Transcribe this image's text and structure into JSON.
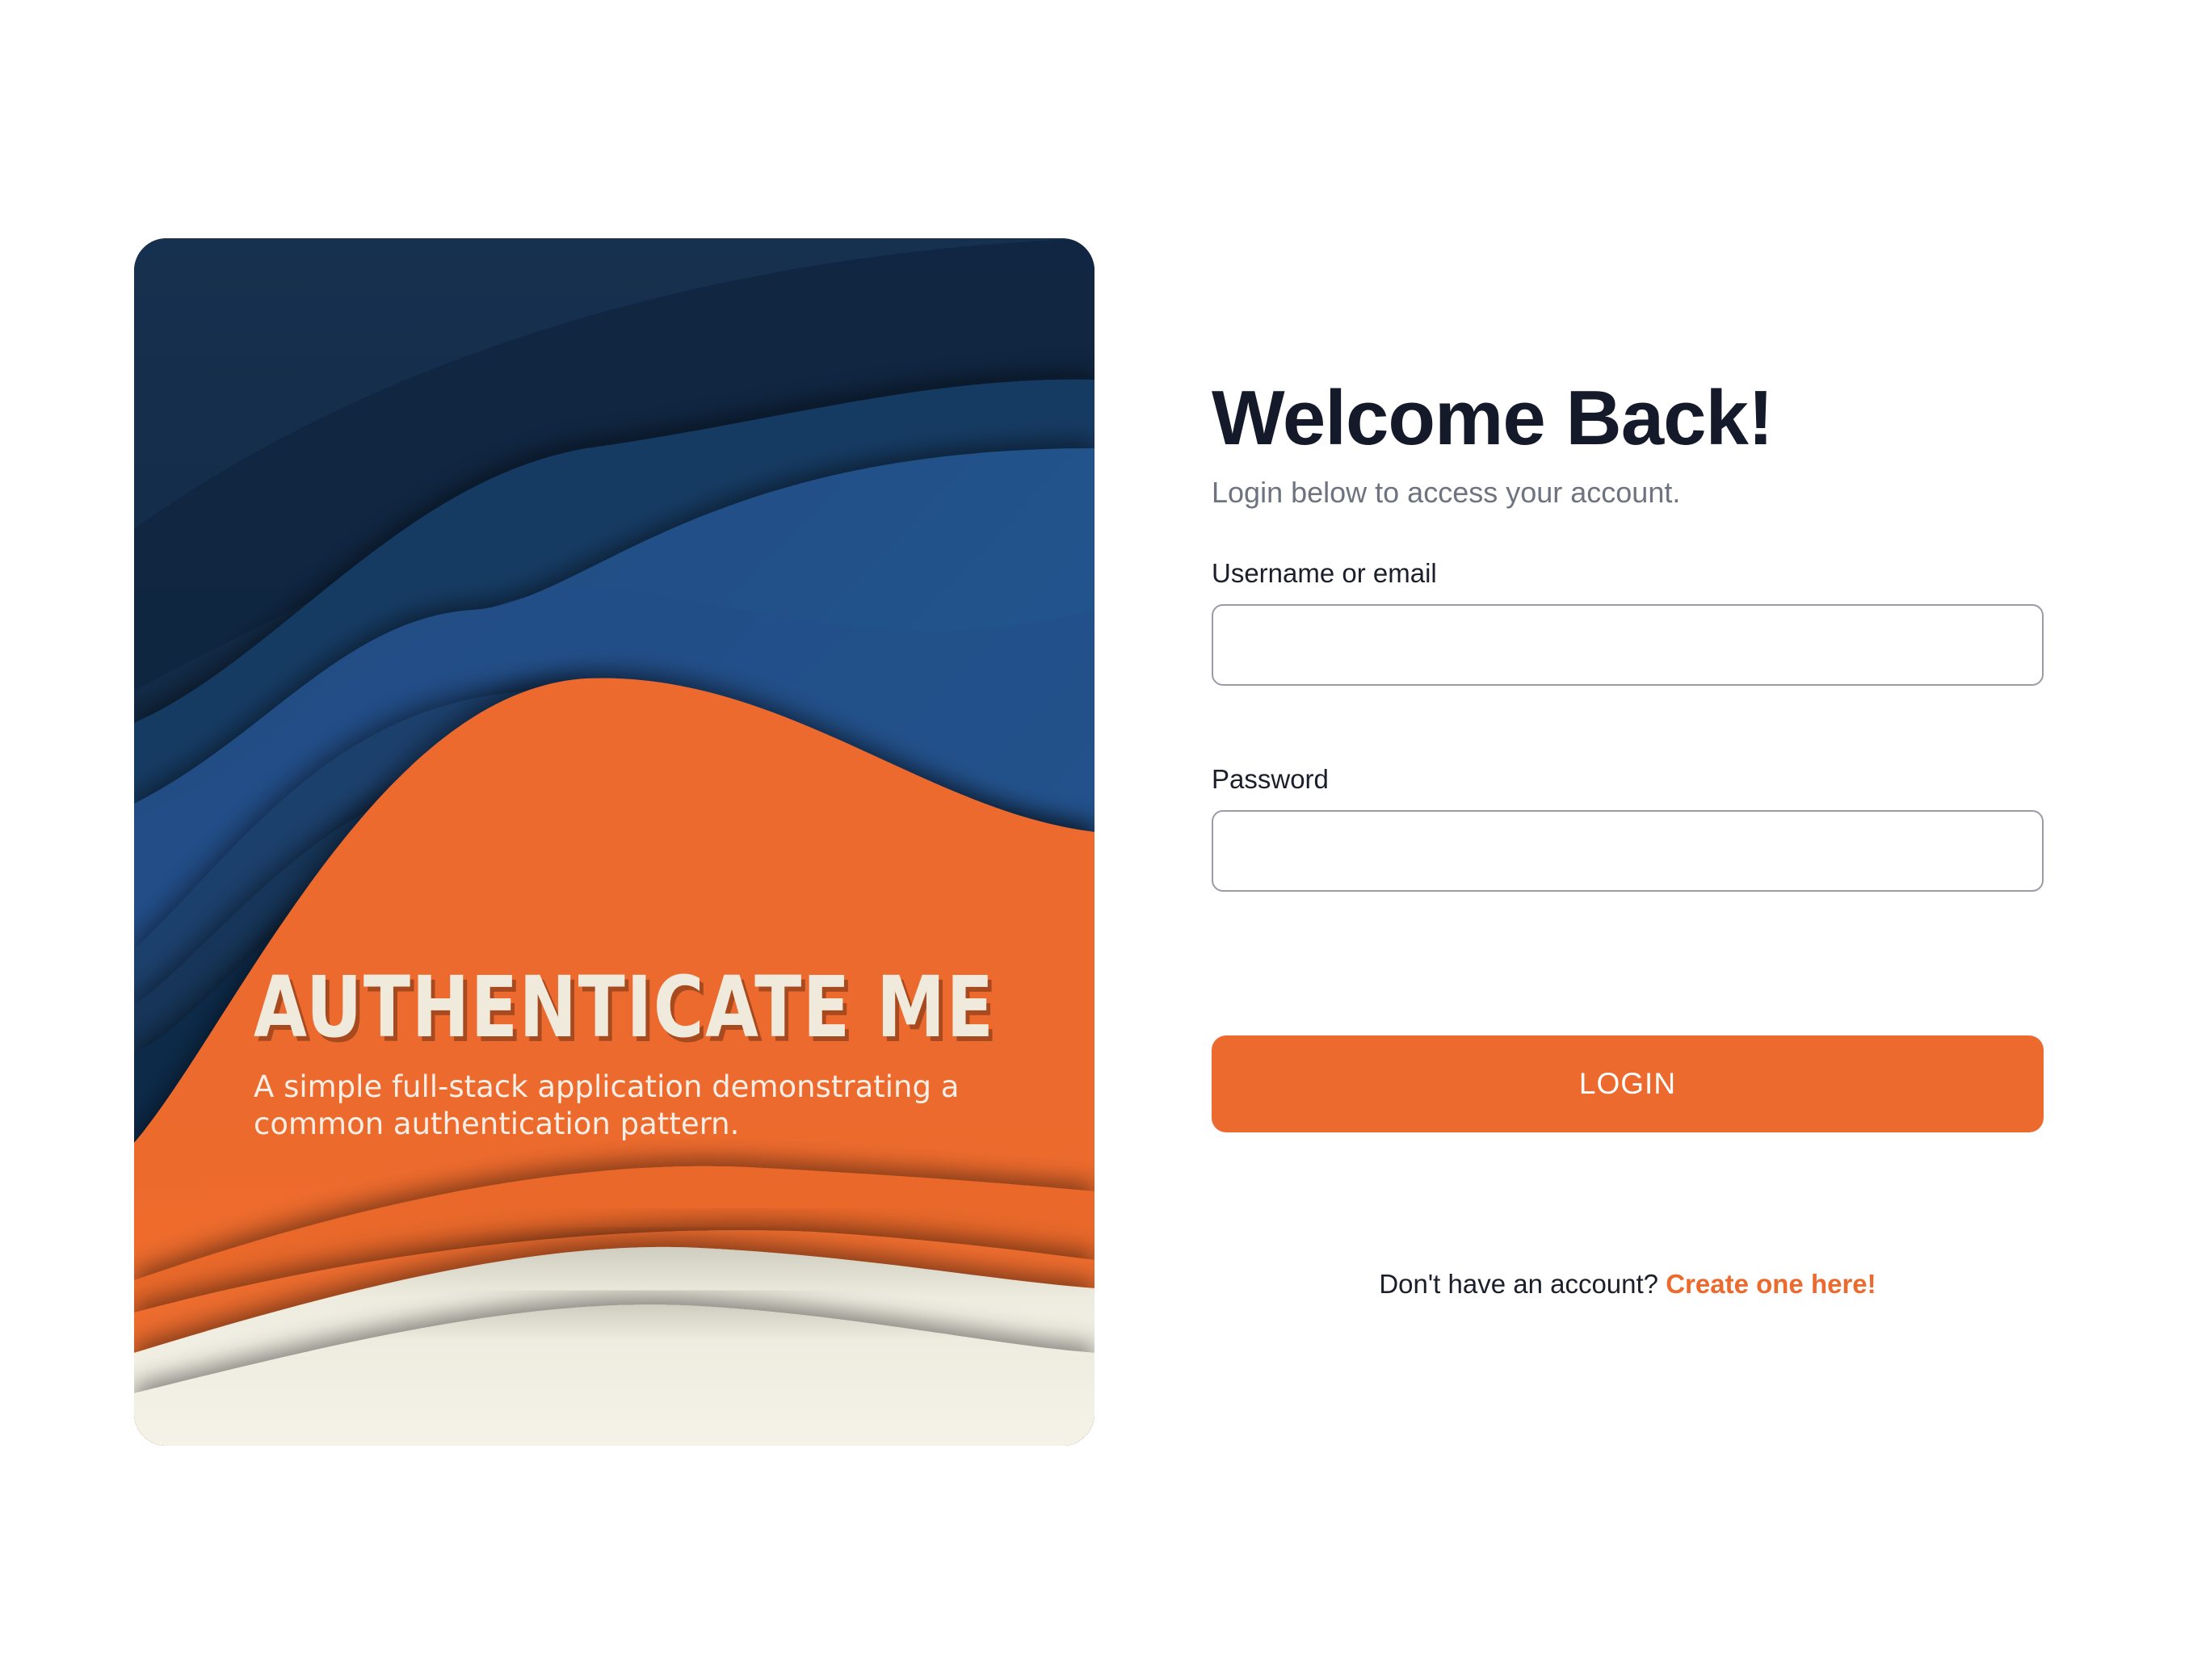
{
  "hero": {
    "title": "AUTHENTICATE ME",
    "subtitle": "A simple full-stack application demonstrating a common authentication pattern."
  },
  "login": {
    "title": "Welcome Back!",
    "subtitle": "Login below to access your account.",
    "username_label": "Username or email",
    "username_value": "",
    "password_label": "Password",
    "password_value": "",
    "submit_label": "LOGIN",
    "signup_prompt": "Don't have an account?",
    "signup_link": "Create one here!"
  },
  "colors": {
    "accent_orange": "#ec6a2d",
    "navy": "#132c4a",
    "blue": "#24558f",
    "cream": "#f4f1e6",
    "heading": "#141a2a",
    "muted_text": "#6e7380"
  }
}
